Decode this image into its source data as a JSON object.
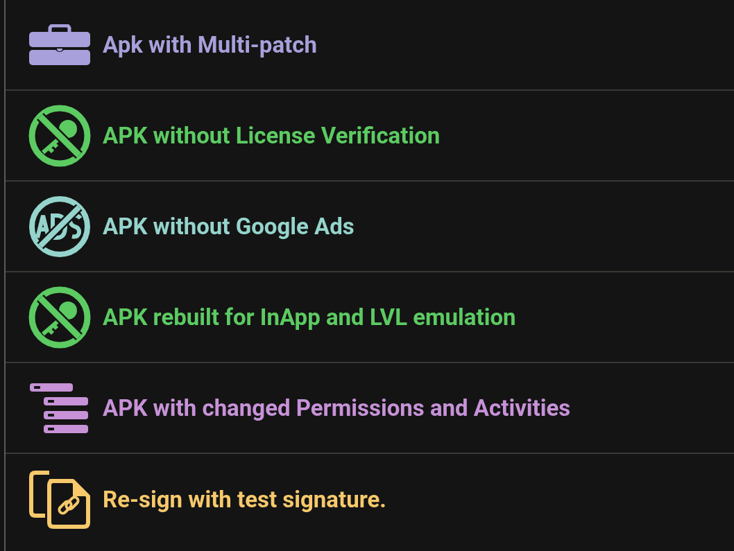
{
  "menu": {
    "items": [
      {
        "kind": "toolbox",
        "label": "Apk with Multi-patch",
        "color": "#a7a0db"
      },
      {
        "kind": "no-key",
        "label": "APK without License Verification",
        "color": "#5ccb62"
      },
      {
        "kind": "no-ads",
        "label": "APK without Google Ads",
        "color": "#95d4cc"
      },
      {
        "kind": "no-key",
        "label": "APK rebuilt for InApp and LVL emulation",
        "color": "#5ccb62"
      },
      {
        "kind": "tree",
        "label": "APK with changed Permissions and Activities",
        "color": "#c792d8"
      },
      {
        "kind": "resign",
        "label": "Re-sign with test signature.",
        "color": "#f7c96b"
      }
    ]
  }
}
